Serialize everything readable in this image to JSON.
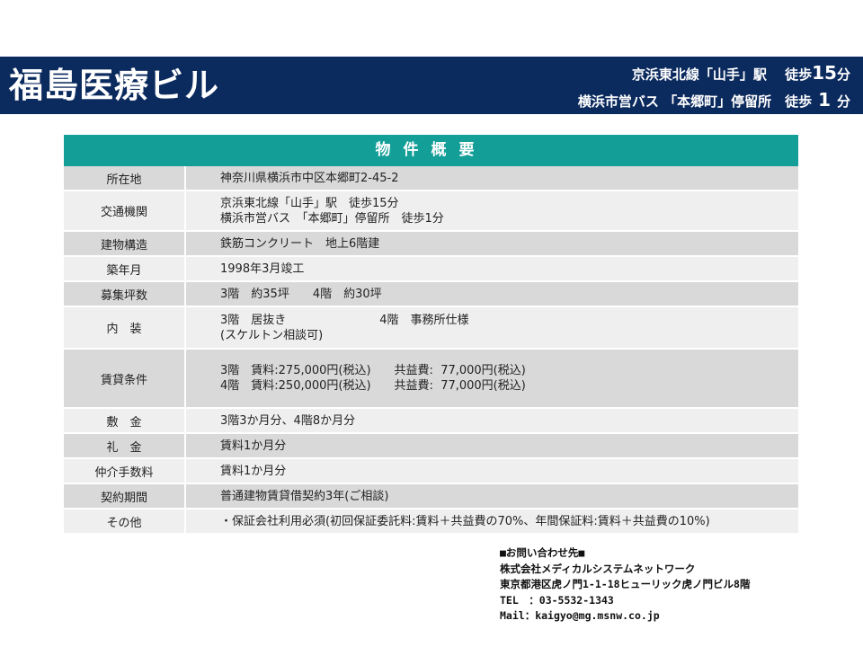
{
  "header": {
    "title": "福島医療ビル",
    "access_line1_prefix": "京浜東北線「山手」駅　 徒歩",
    "access_line1_num": "15",
    "access_line1_suffix": "分",
    "access_line2_prefix": "横浜市営バス 「本郷町」停留所　徒歩",
    "access_line2_num": " 1 ",
    "access_line2_suffix": "分"
  },
  "table": {
    "heading": "物件概要",
    "rows": [
      {
        "key": "所在地",
        "lines": [
          "神奈川県横浜市中区本郷町2-45-2"
        ]
      },
      {
        "key": "交通機関",
        "lines": [
          "京浜東北線「山手」駅　徒歩15分",
          "横浜市営バス　「本郷町」停留所　徒歩1分"
        ]
      },
      {
        "key": "建物構造",
        "lines": [
          "鉄筋コンクリート　地上6階建"
        ]
      },
      {
        "key": "築年月",
        "lines": [
          "1998年3月竣工"
        ]
      },
      {
        "key": "募集坪数",
        "lines": [
          "3階　約35坪　　4階　約30坪"
        ]
      },
      {
        "key": "内　装",
        "lines": [
          "3階　居抜き　　　　　　　　4階　事務所仕様",
          "(スケルトン相談可)"
        ]
      },
      {
        "key": "賃貸条件",
        "lines": [
          "3階　賃料:275,000円(税込)　　共益費:  77,000円(税込)",
          "4階　賃料:250,000円(税込)　　共益費:  77,000円(税込)"
        ]
      },
      {
        "key": "敷　金",
        "lines": [
          "3階3か月分、4階8か月分"
        ]
      },
      {
        "key": "礼　金",
        "lines": [
          "賃料1か月分"
        ]
      },
      {
        "key": "仲介手数料",
        "lines": [
          "賃料1か月分"
        ]
      },
      {
        "key": "契約期間",
        "lines": [
          "普通建物賃貸借契約3年(ご相談)"
        ]
      },
      {
        "key": "その他",
        "lines": [
          "・保証会社利用必須(初回保証委託料:賃料＋共益費の70%、年間保証料:賃料＋共益費の10%)"
        ]
      }
    ]
  },
  "contact": {
    "heading": "■お問い合わせ先■",
    "company": "株式会社メディカルシステムネットワーク",
    "address": "東京都港区虎ノ門1-1-18ヒューリック虎ノ門ビル8階",
    "tel": "TEL　：03-5532-1343",
    "mail": "Mail：kaigyo@mg.msnw.co.jp"
  }
}
